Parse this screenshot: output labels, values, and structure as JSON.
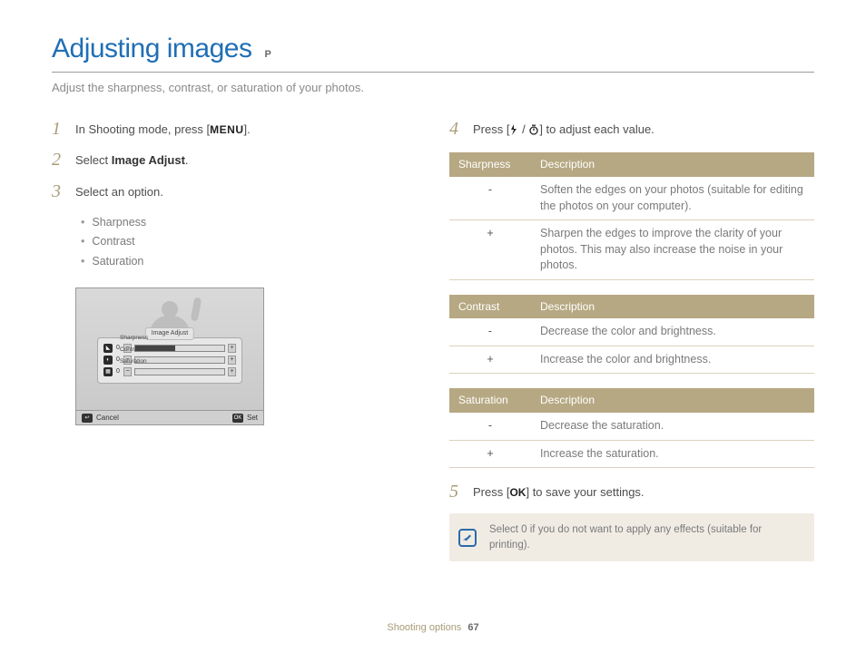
{
  "header": {
    "title": "Adjusting images",
    "mode": "P",
    "subtitle": "Adjust the sharpness, contrast, or saturation of your photos."
  },
  "left": {
    "steps": {
      "s1_a": "In Shooting mode, press [",
      "s1_menu": "MENU",
      "s1_b": "].",
      "s2_a": "Select ",
      "s2_b": "Image Adjust",
      "s2_c": ".",
      "s3": "Select an option."
    },
    "bullets": [
      "Sharpness",
      "Contrast",
      "Saturation"
    ],
    "screen": {
      "panel_title": "Image Adjust",
      "rows": [
        "Sharpness",
        "Contrast",
        "Saturation"
      ],
      "zero": "0",
      "minus": "−",
      "plus": "+",
      "cancel": "Cancel",
      "set": "Set",
      "back_icon": "↩",
      "ok_icon": "OK"
    }
  },
  "right": {
    "s4_a": "Press [",
    "s4_b": "] to adjust each value.",
    "s5_a": "Press [",
    "s5_ok": "OK",
    "s5_b": "] to save your settings.",
    "tables": {
      "sharpness": {
        "h1": "Sharpness",
        "h2": "Description",
        "rows": [
          {
            "k": "-",
            "v": "Soften the edges on your photos (suitable for editing the photos on your computer)."
          },
          {
            "k": "+",
            "v": "Sharpen the edges to improve the clarity of your photos. This may also increase the noise in your photos."
          }
        ]
      },
      "contrast": {
        "h1": "Contrast",
        "h2": "Description",
        "rows": [
          {
            "k": "-",
            "v": "Decrease the color and brightness."
          },
          {
            "k": "+",
            "v": "Increase the color and brightness."
          }
        ]
      },
      "saturation": {
        "h1": "Saturation",
        "h2": "Description",
        "rows": [
          {
            "k": "-",
            "v": "Decrease the saturation."
          },
          {
            "k": "+",
            "v": "Increase the saturation."
          }
        ]
      }
    },
    "note": "Select 0 if you do not want to apply any effects (suitable for printing)."
  },
  "footer": {
    "section": "Shooting options",
    "page": "67"
  }
}
